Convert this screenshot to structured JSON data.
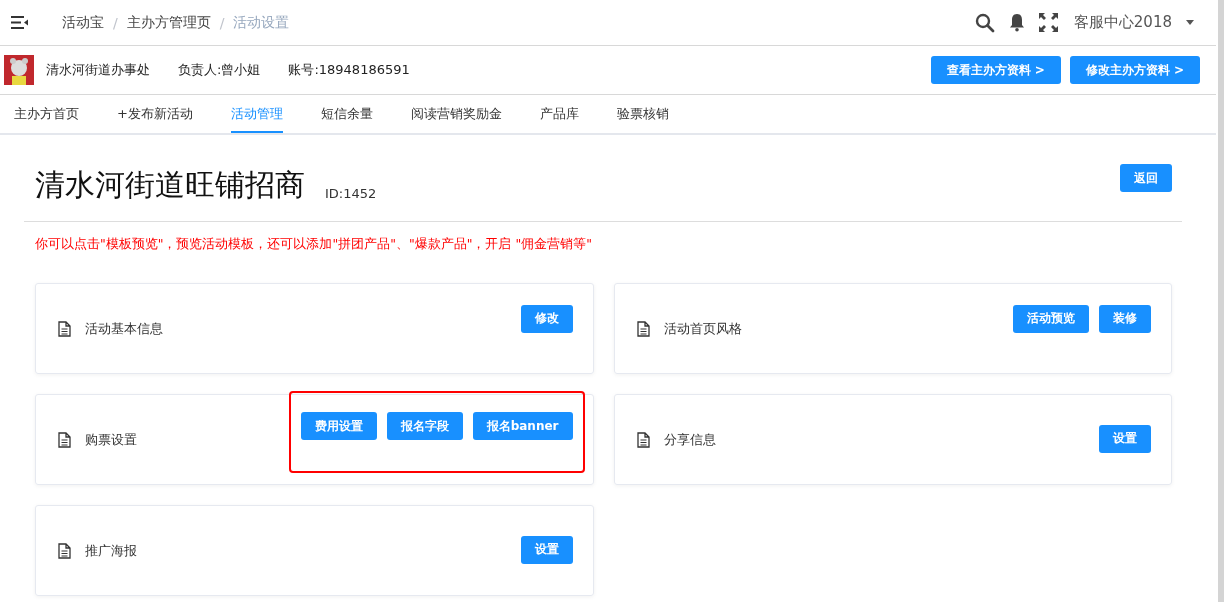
{
  "breadcrumb": [
    {
      "label": "活动宝",
      "selected": false
    },
    {
      "label": "主办方管理页",
      "selected": false
    },
    {
      "label": "活动设置",
      "selected": true
    }
  ],
  "breadcrumb_separator": "/",
  "user": {
    "name": "客服中心2018"
  },
  "organizer": {
    "name": "清水河街道办事处",
    "contact": "负责人:曾小姐",
    "account": "账号:18948186591",
    "buttons": [
      "查看主办方资料 >",
      "修改主办方资料 >"
    ]
  },
  "nav_tabs": [
    {
      "label": "主办方首页",
      "selected": false
    },
    {
      "label": "+发布新活动",
      "selected": false
    },
    {
      "label": "活动管理",
      "selected": true
    },
    {
      "label": "短信余量",
      "selected": false
    },
    {
      "label": "阅读营销奖励金",
      "selected": false
    },
    {
      "label": "产品库",
      "selected": false
    },
    {
      "label": "验票核销",
      "selected": false
    }
  ],
  "activity": {
    "title": "清水河街道旺铺招商",
    "id": "ID:1452",
    "back_button": "返回"
  },
  "notice": "你可以点击\"模板预览\"，预览活动模板，还可以添加\"拼团产品\"、\"爆款产品\"，开启 \"佣金营销等\"",
  "cards": [
    {
      "title": "活动基本信息",
      "buttons": [
        "修改"
      ],
      "highlighted": false
    },
    {
      "title": "活动首页风格",
      "buttons": [
        "活动预览",
        "装修"
      ],
      "highlighted": false
    },
    {
      "title": "购票设置",
      "buttons": [
        "费用设置",
        "报名字段",
        "报名banner"
      ],
      "highlighted": true
    },
    {
      "title": "分享信息",
      "buttons": [
        "设置"
      ],
      "highlighted": false
    },
    {
      "title": "推广海报",
      "buttons": [
        "设置"
      ],
      "highlighted": false
    }
  ]
}
